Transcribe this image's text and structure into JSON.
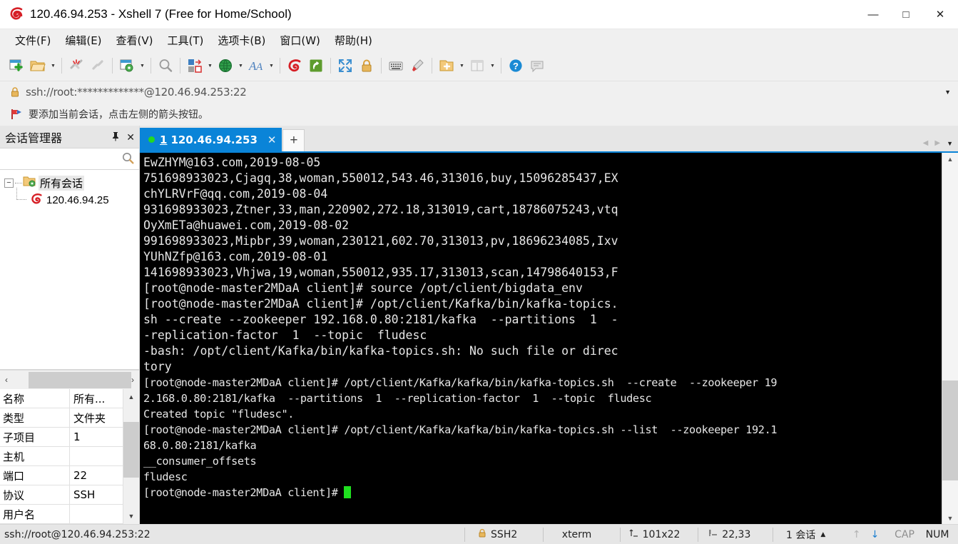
{
  "window": {
    "title": "120.46.94.253 - Xshell 7 (Free for Home/School)",
    "logo_icon": "xshell-logo-icon",
    "minimize_label": "—",
    "maximize_label": "□",
    "close_label": "✕"
  },
  "menubar": {
    "items": [
      {
        "label": "文件(F)",
        "name": "menu-file"
      },
      {
        "label": "编辑(E)",
        "name": "menu-edit"
      },
      {
        "label": "查看(V)",
        "name": "menu-view"
      },
      {
        "label": "工具(T)",
        "name": "menu-tools"
      },
      {
        "label": "选项卡(B)",
        "name": "menu-tabs"
      },
      {
        "label": "窗口(W)",
        "name": "menu-window"
      },
      {
        "label": "帮助(H)",
        "name": "menu-help"
      }
    ]
  },
  "toolbar": {
    "items": [
      "new-session-icon",
      "open-folder-icon",
      "dropdown-arrow",
      "separator",
      "disconnect-icon",
      "reconnect-icon",
      "separator",
      "session-properties-icon",
      "dropdown-arrow",
      "separator",
      "find-icon",
      "separator",
      "layout-icon",
      "dropdown-arrow",
      "globe-icon",
      "dropdown-arrow",
      "font-icon",
      "dropdown-arrow",
      "separator",
      "xshell-icon",
      "xftp-icon",
      "separator",
      "fullscreen-icon",
      "lock-icon",
      "separator",
      "keyboard-icon",
      "highlight-icon",
      "separator",
      "new-note-icon",
      "dropdown-arrow",
      "split-view-icon",
      "dropdown-arrow",
      "separator",
      "help-icon",
      "chat-icon"
    ]
  },
  "address_bar": {
    "lock_icon": "lock-icon",
    "url": "ssh://root:*************@120.46.94.253:22",
    "caret_icon": "chevron-down-icon"
  },
  "notice_bar": {
    "flag_icon": "red-flag-icon",
    "text": "要添加当前会话，点击左侧的箭头按钮。"
  },
  "session_manager": {
    "title": "会话管理器",
    "pin_icon": "pin-icon",
    "close_icon": "close-icon",
    "search": {
      "placeholder": "",
      "value": "",
      "icon": "search-icon"
    },
    "tree": {
      "root": {
        "label": "所有会话",
        "icon": "folder-settings-icon",
        "expander": "−"
      },
      "children": [
        {
          "label": "120.46.94.25",
          "icon": "xshell-session-icon"
        }
      ]
    },
    "hscroll": {
      "left_arrow": "‹",
      "right_arrow": "›"
    },
    "properties": {
      "rows": [
        {
          "key": "名称",
          "value": "所有..."
        },
        {
          "key": "类型",
          "value": "文件夹"
        },
        {
          "key": "子项目",
          "value": "1"
        },
        {
          "key": "主机",
          "value": ""
        },
        {
          "key": "端口",
          "value": "22"
        },
        {
          "key": "协议",
          "value": "SSH"
        },
        {
          "key": "用户名",
          "value": ""
        }
      ],
      "scroll_up_icon": "chevron-up-icon",
      "scroll_down_icon": "chevron-down-icon"
    }
  },
  "tabbar": {
    "tabs": [
      {
        "status_dot": "connected",
        "number": "1",
        "name": "120.46.94.253",
        "close_icon": "close-icon"
      }
    ],
    "new_tab_label": "+",
    "nav_prev_icon": "triangle-left-icon",
    "nav_next_icon": "triangle-right-icon",
    "nav_dropdown_icon": "chevron-down-icon"
  },
  "terminal": {
    "cursor_color": "#1fe01f",
    "lines": [
      {
        "text": "EwZHYM@163.com,2019-08-05",
        "narrow": false
      },
      {
        "text": "751698933023,Cjagq,38,woman,550012,543.46,313016,buy,15096285437,EX",
        "narrow": false
      },
      {
        "text": "chYLRVrF@qq.com,2019-08-04",
        "narrow": false
      },
      {
        "text": "931698933023,Ztner,33,man,220902,272.18,313019,cart,18786075243,vtq",
        "narrow": false
      },
      {
        "text": "OyXmETa@huawei.com,2019-08-02",
        "narrow": false
      },
      {
        "text": "991698933023,Mipbr,39,woman,230121,602.70,313013,pv,18696234085,Ixv",
        "narrow": false
      },
      {
        "text": "YUhNZfp@163.com,2019-08-01",
        "narrow": false
      },
      {
        "text": "141698933023,Vhjwa,19,woman,550012,935.17,313013,scan,14798640153,F",
        "narrow": false
      },
      {
        "text": "[root@node-master2MDaA client]# source /opt/client/bigdata_env",
        "narrow": false
      },
      {
        "text": "[root@node-master2MDaA client]# /opt/client/Kafka/bin/kafka-topics.",
        "narrow": false
      },
      {
        "text": "sh --create --zookeeper 192.168.0.80:2181/kafka  --partitions  1  -",
        "narrow": false
      },
      {
        "text": "-replication-factor  1  --topic  fludesc",
        "narrow": false
      },
      {
        "text": "-bash: /opt/client/Kafka/bin/kafka-topics.sh: No such file or direc",
        "narrow": false
      },
      {
        "text": "tory",
        "narrow": false
      },
      {
        "text": "[root@node-master2MDaA client]# /opt/client/Kafka/kafka/bin/kafka-topics.sh  --create  --zookeeper 19",
        "narrow": true
      },
      {
        "text": "2.168.0.80:2181/kafka  --partitions  1  --replication-factor  1  --topic  fludesc",
        "narrow": true
      },
      {
        "text": "Created topic \"fludesc\".",
        "narrow": true
      },
      {
        "text": "[root@node-master2MDaA client]# /opt/client/Kafka/kafka/bin/kafka-topics.sh --list  --zookeeper 192.1",
        "narrow": true
      },
      {
        "text": "68.0.80:2181/kafka",
        "narrow": true
      },
      {
        "text": "__consumer_offsets",
        "narrow": true
      },
      {
        "text": "fludesc",
        "narrow": true
      },
      {
        "text": "[root@node-master2MDaA client]# ",
        "narrow": true,
        "cursor": true
      }
    ],
    "scroll_up_icon": "chevron-up-icon",
    "scroll_down_icon": "chevron-down-icon"
  },
  "statusbar": {
    "url": "ssh://root@120.46.94.253:22",
    "lock_icon": "lock-icon",
    "protocol": "SSH2",
    "terminal_type": "xterm",
    "size_icon": "resize-icon",
    "size": "101x22",
    "position_icon": "cursor-position-icon",
    "position": "22,33",
    "sessions": "1 会话",
    "sessions_caret": "▲",
    "upload_icon": "arrow-up-icon",
    "download_icon": "arrow-down-icon",
    "cap": "CAP",
    "num": "NUM"
  }
}
